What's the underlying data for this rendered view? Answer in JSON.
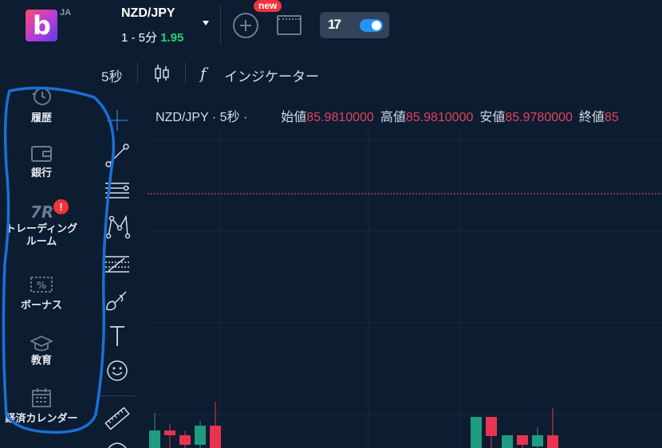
{
  "header": {
    "logo_letter": "b",
    "language": "JA",
    "pair": "NZD/JPY",
    "timeframe": "1 - 5分",
    "payout": "1.95",
    "new_badge": "new",
    "tv_logo": "17"
  },
  "toolbar": {
    "interval": "5秒",
    "fx_symbol": "f",
    "indicators_label": "インジケーター"
  },
  "sidebar": {
    "items": [
      {
        "label": "履歴",
        "icon": "history-icon"
      },
      {
        "label": "銀行",
        "icon": "wallet-icon"
      },
      {
        "label": "トレーディング\nルーム",
        "icon": "trading-room-icon",
        "alert": "!"
      },
      {
        "label": "ボーナス",
        "icon": "bonus-ticket-icon"
      },
      {
        "label": "教育",
        "icon": "graduation-cap-icon"
      },
      {
        "label": "経済カレンダー",
        "icon": "calendar-icon"
      }
    ]
  },
  "tools": [
    "crosshair-icon",
    "trend-line-icon",
    "horizontal-lines-icon",
    "pattern-icon",
    "fib-icon",
    "brush-icon",
    "text-icon",
    "emoji-icon",
    "ruler-icon"
  ],
  "chart": {
    "symbol": "NZD/JPY · 5秒 ·",
    "open_label": "始値",
    "open_value": "85.9810000",
    "high_label": "高値",
    "high_value": "85.9810000",
    "low_label": "安値",
    "low_value": "85.9780000",
    "close_label": "終値",
    "close_value": "85",
    "colors": {
      "up": "#1f9b7f",
      "down": "#e8344f",
      "grid": "#18283e",
      "background": "#0c1c31"
    }
  },
  "annotation_color": "#1a6fd6"
}
